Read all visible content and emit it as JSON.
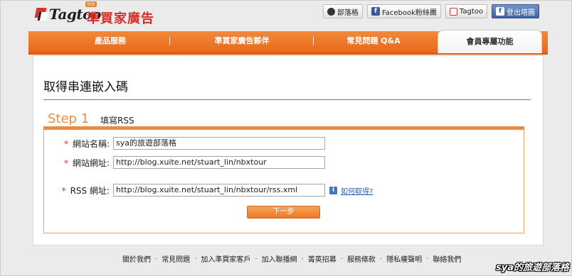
{
  "header": {
    "logo_text": "Tagtoo",
    "logo_badge": "5th",
    "brand": "準買家廣告",
    "tools": {
      "blog": "部落格",
      "facebook_fans": "Facebook粉絲團",
      "tagtoo": "Tagtoo",
      "fb_login": "登出塔圖"
    }
  },
  "nav": {
    "items": [
      "產品服務",
      "準買家廣告夥伴",
      "常見問題 Q&A"
    ],
    "active": "會員專屬功能"
  },
  "page": {
    "title": "取得串連嵌入碼",
    "step_label": "Step 1",
    "step_sub": "填寫RSS"
  },
  "form": {
    "star": "*",
    "site_name_label": "網站名稱:",
    "site_name_value": "sya的旅遊部落格",
    "site_url_label": "網站網址:",
    "site_url_value": "http://blog.xuite.net/stuart_lin/nbxtour",
    "rss_label": "RSS 網址:",
    "rss_value": "http://blog.xuite.net/stuart_lin/nbxtour/rss.xml",
    "help_icon": "i",
    "help_link": "如何取得?",
    "next_button": "下一步"
  },
  "footer": {
    "links": [
      "關於我們",
      "常見問題",
      "加入準買家客戶",
      "加入聯播網",
      "菁英招募",
      "服務條款",
      "隱私權聲明",
      "聯絡我們"
    ],
    "separator": "."
  },
  "watermark": "sya的旅遊部落格",
  "colors": {
    "accent": "#f08a3a",
    "brand_red": "#d6302a",
    "link": "#2a5ab8"
  }
}
